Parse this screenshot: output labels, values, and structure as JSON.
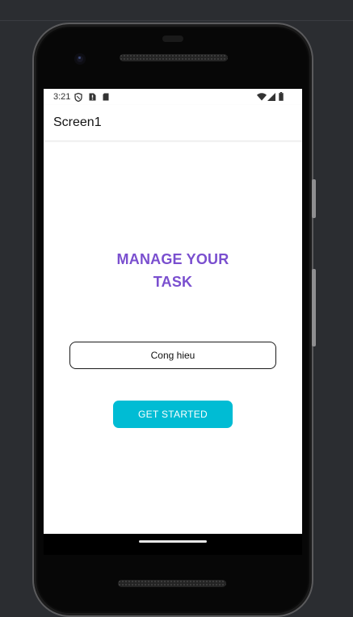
{
  "status_bar": {
    "time": "3:21",
    "left_icons": [
      "shield-icon",
      "sim-alert-icon",
      "sd-card-icon"
    ],
    "right_icons": [
      "wifi-icon",
      "cell-signal-icon",
      "battery-icon"
    ]
  },
  "app_bar": {
    "title": "Screen1"
  },
  "main": {
    "headline_line1": "MANAGE YOUR",
    "headline_line2": "TASK",
    "name_input": {
      "value": "Cong hieu",
      "placeholder": ""
    },
    "start_button_label": "GET STARTED"
  },
  "colors": {
    "headline": "#7a4fcf",
    "button": "#00bcd4",
    "emulator_background": "#2b2d31"
  }
}
